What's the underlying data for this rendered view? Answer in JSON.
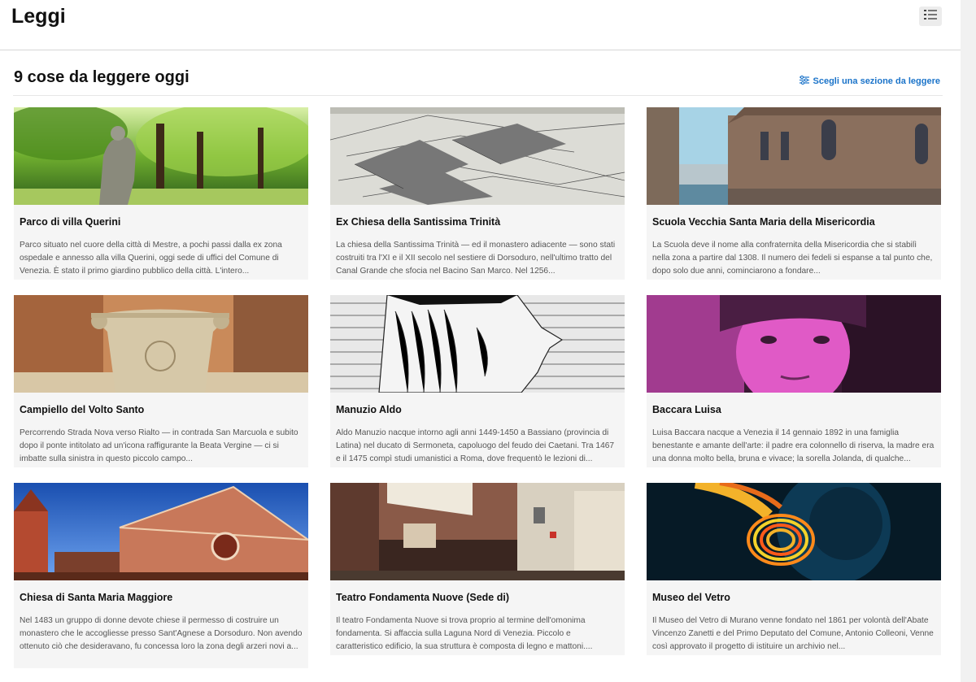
{
  "header": {
    "title": "Leggi",
    "menu_icon": "list-icon"
  },
  "section": {
    "title": "9 cose da leggere oggi",
    "link_label": "Scegli una sezione da leggere",
    "link_icon": "sliders-icon",
    "link_color": "#1a73c9"
  },
  "cards": [
    {
      "title": "Parco di villa Querini",
      "text": "Parco situato nel cuore della città di Mestre, a pochi passi dalla ex zona ospedale e annesso alla villa Querini, oggi sede di uffici del Comune di Venezia. È stato il primo giardino pubblico della città. L'intero...",
      "image": "park-statue-image"
    },
    {
      "title": "Ex Chiesa della Santissima Trinità",
      "text": "La chiesa della Santissima Trinità — ed il monastero adiacente — sono stati costruiti tra l'XI e il XII secolo nel sestiere di Dorsoduro, nell'ultimo tratto del Canal Grande che sfocia nel Bacino San Marco. Nel 1256...",
      "image": "engraving-map-image"
    },
    {
      "title": "Scuola Vecchia Santa Maria della Misericordia",
      "text": "La Scuola deve il nome alla confraternita della Misericordia che si stabilì nella zona a partire dal 1308. Il numero dei fedeli si espanse a tal punto che, dopo solo due anni, cominciarono a fondare...",
      "image": "canal-building-image"
    },
    {
      "title": "Campiello del Volto Santo",
      "text": "Percorrendo Strada Nova verso Rialto — in contrada San Marcuola e subito dopo il ponte intitolato ad un'icona raffigurante la Beata Vergine — ci si imbatte sulla sinistra in questo piccolo campo...",
      "image": "wellhead-image"
    },
    {
      "title": "Manuzio Aldo",
      "text": "Aldo Manuzio nacque intorno agli anni 1449-1450 a Bassiano (provincia di Latina) nel ducato di Sermoneta, capoluogo del feudo dei Caetani. Tra 1467 e il 1475 compì studi umanistici a Roma, dove frequentò le lezioni di...",
      "image": "portrait-engraving-image"
    },
    {
      "title": "Baccara Luisa",
      "text": "Luisa Baccara nacque a Venezia il 14 gennaio 1892 in una famiglia benestante e amante dell'arte: il padre era colonnello di riserva, la madre era una donna molto bella, bruna e vivace; la sorella Jolanda, di qualche...",
      "image": "woman-portrait-image"
    },
    {
      "title": "Chiesa di Santa Maria Maggiore",
      "text": "Nel 1483 un gruppo di donne devote chiese il permesso di costruire un monastero che le accogliesse presso Sant'Agnese a Dorsoduro. Non avendo ottenuto ciò che desideravano, fu concessa loro la zona degli arzeri novi a...",
      "image": "church-facade-image"
    },
    {
      "title": "Teatro Fondamenta Nuove (Sede di)",
      "text": "Il teatro Fondamenta Nuove si trova proprio al termine dell'omonima fondamenta. Si affaccia sulla Laguna Nord di Venezia.  Piccolo e caratteristico edificio, la sua struttura è composta di legno e mattoni....",
      "image": "theatre-street-image"
    },
    {
      "title": "Museo del Vetro",
      "text": "Il Museo del Vetro di Murano venne fondato nel 1861 per volontà dell'Abate Vincenzo Zanetti e del Primo Deputato del Comune, Antonio Colleoni, Venne così approvato il progetto di istituire un archivio nel...",
      "image": "glass-furnace-image"
    }
  ]
}
